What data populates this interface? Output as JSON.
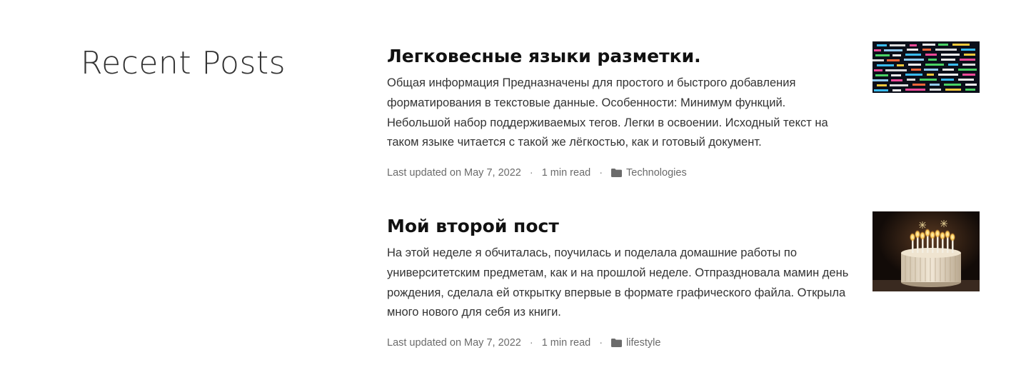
{
  "section": {
    "title": "Recent Posts"
  },
  "posts": [
    {
      "title": "Легковесные языки разметки.",
      "summary": "Общая информация Предназначены для простого и быстрого добавления форматирования в текстовые данные. Особенности: Минимум функций. Небольшой набор поддерживаемых тегов. Легки в освоении. Исходный текст на таком языке читается с такой же лёгкостью, как и готовый документ.",
      "updated": "Last updated on May 7, 2022",
      "read_time": "1 min read",
      "category": "Technologies",
      "separator": "·",
      "thumbnail": "code-screen-image"
    },
    {
      "title": "Мой второй пост",
      "summary": "На этой неделе я обчиталась, поучилась и поделала домашние работы по университетским предметам, как и на прошлой неделе. Отпраздновала мамин день рождения, сделала ей открытку впервые в формате графического файла. Открыла много нового для себя из книги.",
      "updated": "Last updated on May 7, 2022",
      "read_time": "1 min read",
      "category": "lifestyle",
      "separator": "·",
      "thumbnail": "birthday-cake-image"
    }
  ],
  "colors": {
    "text": "#333333",
    "heading": "#111111",
    "meta": "#6b6b6b",
    "background": "#ffffff"
  }
}
